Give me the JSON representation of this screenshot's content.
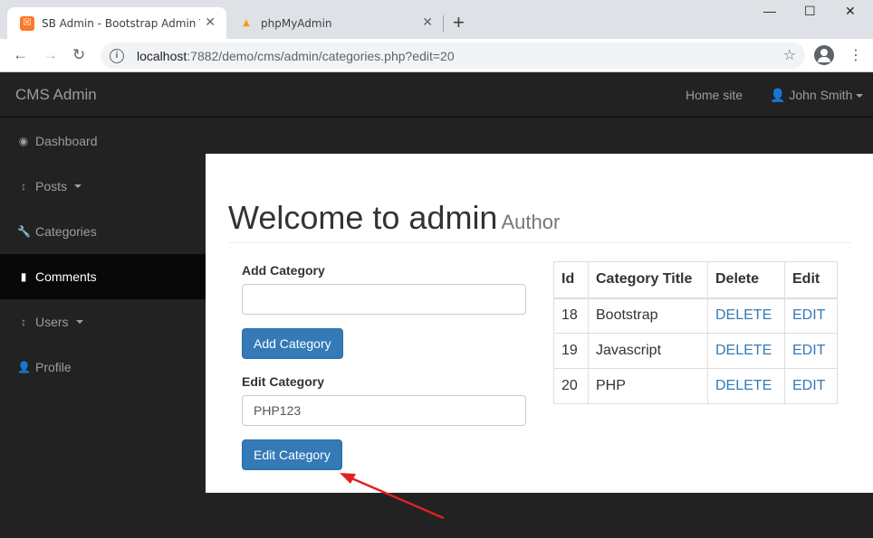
{
  "browser": {
    "tabs": [
      {
        "title": "SB Admin - Bootstrap Admin Template",
        "favicon": "xampp-icon",
        "active": true
      },
      {
        "title": "phpMyAdmin",
        "favicon": "pma-icon",
        "active": false
      }
    ],
    "url_host": "localhost",
    "url_rest": ":7882/demo/cms/admin/categories.php?edit=20"
  },
  "navbar": {
    "brand": "CMS Admin",
    "home_site": "Home site",
    "user": "John Smith"
  },
  "sidebar": {
    "items": [
      {
        "label": "Dashboard",
        "icon": "dashboard-icon"
      },
      {
        "label": "Posts",
        "icon": "arrows-v-icon"
      },
      {
        "label": "Categories",
        "icon": "wrench-icon"
      },
      {
        "label": "Comments",
        "icon": "file-icon"
      },
      {
        "label": "Users",
        "icon": "arrows-v-icon"
      },
      {
        "label": "Profile",
        "icon": "user-icon"
      }
    ]
  },
  "main": {
    "title": "Welcome to admin",
    "subtitle": "Author",
    "add_label": "Add Category",
    "add_value": "",
    "add_button": "Add Category",
    "edit_label": "Edit Category",
    "edit_value": "PHP123",
    "edit_button": "Edit Category"
  },
  "table": {
    "headers": [
      "Id",
      "Category Title",
      "Delete",
      "Edit"
    ],
    "rows": [
      {
        "id": "18",
        "title": "Bootstrap",
        "delete": "DELETE",
        "edit": "EDIT"
      },
      {
        "id": "19",
        "title": "Javascript",
        "delete": "DELETE",
        "edit": "EDIT"
      },
      {
        "id": "20",
        "title": "PHP",
        "delete": "DELETE",
        "edit": "EDIT"
      }
    ]
  },
  "colors": {
    "primary": "#337ab7",
    "navbar": "#222222",
    "sidebar_active": "#080808",
    "annotation_arrow": "#e02020"
  }
}
